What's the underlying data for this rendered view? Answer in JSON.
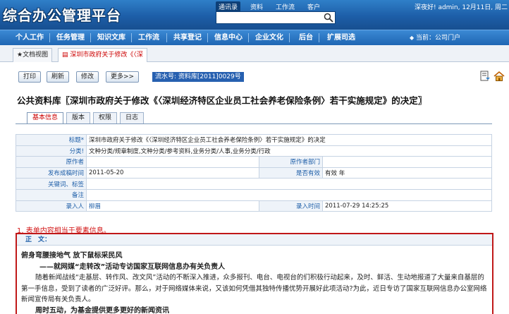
{
  "app": {
    "title": "综合办公管理平台",
    "user_info": "深夜好! admin, 12月11日, 周二"
  },
  "search": {
    "tabs": [
      "通讯录",
      "资料",
      "工作流",
      "客户"
    ],
    "active_tab": "通讯录",
    "placeholder": ""
  },
  "nav": {
    "items": [
      "个人工作",
      "任务管理",
      "知识文库",
      "工作流",
      "共享登记",
      "信息中心",
      "企业文化",
      "后台",
      "扩展司选"
    ],
    "current": "当前：公司门户"
  },
  "strip_tabs": [
    {
      "label": "★文档视图",
      "active": false
    },
    {
      "label": "深圳市政府关于修改《〈深",
      "active": true
    }
  ],
  "toolbar": {
    "print": "打印",
    "refresh": "刷新",
    "edit": "修改",
    "more": "更多>>",
    "flow_no": "流水号: 资料库[2011]0029号"
  },
  "doc": {
    "title": "公共资料库〖深圳市政府关于修改《〈深圳经济特区企业员工社会养老保险条例〉若干实施规定》的决定〗"
  },
  "subtabs": [
    "基本信息",
    "版本",
    "权限",
    "日志"
  ],
  "form": {
    "title_label": "标题*",
    "title_value": "深圳市政府关于修改《〈深圳经济特区企业员工社会养老保险条例〉若干实施规定》的决定",
    "category_label": "分类!",
    "category_value": "文种分类/规章制度,文种分类/参考资料,业务分类/人事,业务分类/行政",
    "author_label": "原作者",
    "author_value": "",
    "author_dept_label": "原作者部门",
    "author_dept_value": "",
    "publish_label": "发布成稿时间",
    "publish_value": "2011-05-20",
    "valid_label": "是否有效",
    "valid_value": "有效  年",
    "keywords_label": "关键词、标签",
    "keywords_value": "",
    "remark_label": "备注",
    "remark_value": "",
    "entry_person_label": "录入人",
    "entry_person_value": "柳眉",
    "entry_time_label": "录入时间",
    "entry_time_value": "2011-07-29 14:25:25"
  },
  "annotation": "1. 表单内容相当于要素信息。",
  "content": {
    "head": "正　文：",
    "h1": "俯身弯腰接地气 放下鼠标采民风",
    "h2": "——就网媒“走转改”活动专访国家互联网信息办有关负责人",
    "p": "随着新闻战线“走基层、转作风、改文风”活动的不断深入推进，众多报刊、电台、电视台的们积极行动起来，及时、鲜活、生动地报道了大量来自基层的第一手信息，受到了读者的广泛好评。那么，对于网络媒体来说，又该如何凭借其独特传播优势开展好此项活动?为此，近日专访了国家互联网信息办公室网络新闻宣传局有关负责人。",
    "h3": "周时五动，为基金提供更多更好的新闻资讯"
  },
  "colors": {
    "header_blue": "#1d5ea8",
    "accent_red": "#c01818"
  }
}
